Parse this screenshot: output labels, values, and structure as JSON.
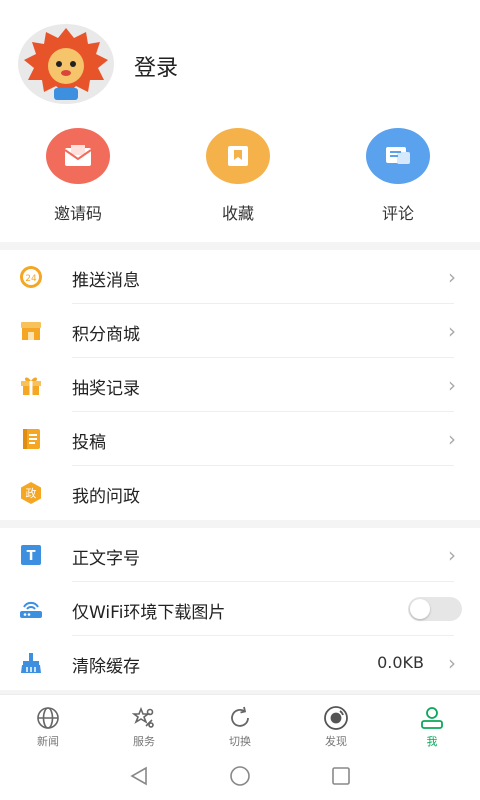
{
  "header": {
    "login_label": "登录"
  },
  "quick_actions": [
    {
      "label": "邀请码",
      "icon": "envelope-icon",
      "color": "#f26c5c"
    },
    {
      "label": "收藏",
      "icon": "bookmark-icon",
      "color": "#f6b24a"
    },
    {
      "label": "评论",
      "icon": "comment-icon",
      "color": "#5aa2ee"
    }
  ],
  "menu_section_1": [
    {
      "label": "推送消息",
      "icon": "clock-24-icon",
      "badge": "24"
    },
    {
      "label": "积分商城",
      "icon": "shop-icon"
    },
    {
      "label": "抽奖记录",
      "icon": "gift-icon"
    },
    {
      "label": "投稿",
      "icon": "notebook-icon"
    },
    {
      "label": "我的问政",
      "icon": "politics-icon",
      "badge": "政"
    }
  ],
  "menu_section_2": [
    {
      "label": "正文字号",
      "icon": "font-size-icon",
      "badge": "T"
    },
    {
      "label": "仅WiFi环境下载图片",
      "icon": "router-icon",
      "toggle_on": false
    },
    {
      "label": "清除缓存",
      "icon": "broom-icon",
      "value": "0.0KB"
    }
  ],
  "tabbar": [
    {
      "label": "新闻",
      "icon": "globe-icon"
    },
    {
      "label": "服务",
      "icon": "service-icon"
    },
    {
      "label": "切换",
      "icon": "refresh-icon"
    },
    {
      "label": "发现",
      "icon": "discover-icon"
    },
    {
      "label": "我",
      "icon": "person-icon",
      "active": true
    }
  ],
  "colors": {
    "accent_green": "#0aa85a",
    "icon_orange": "#f5a623"
  }
}
